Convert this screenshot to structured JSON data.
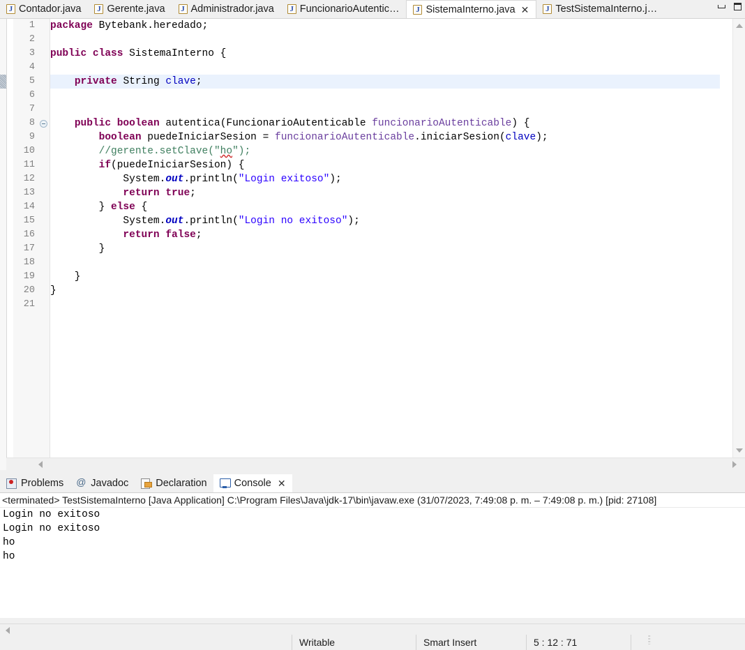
{
  "window": {
    "minimize_label": "Minimize",
    "maximize_label": "Maximize"
  },
  "editor_tabs": [
    {
      "label": "Contador.java",
      "icon": "java-file-icon",
      "active": false,
      "closable": false
    },
    {
      "label": "Gerente.java",
      "icon": "java-file-icon",
      "active": false,
      "closable": false
    },
    {
      "label": "Administrador.java",
      "icon": "java-file-icon",
      "active": false,
      "closable": false
    },
    {
      "label": "FuncionarioAutentic…",
      "icon": "java-file-icon",
      "active": false,
      "closable": false
    },
    {
      "label": "SistemaInterno.java",
      "icon": "java-file-icon",
      "active": true,
      "closable": true
    },
    {
      "label": "TestSistemaInterno.j…",
      "icon": "java-file-icon",
      "active": false,
      "closable": false
    }
  ],
  "editor": {
    "close_glyph": "✕",
    "highlighted_line": 5,
    "fold_marker_line": 8,
    "change_marker_line": 5,
    "line_count": 21,
    "lines": [
      {
        "n": 1,
        "text": "package Bytebank.heredado;"
      },
      {
        "n": 2,
        "text": ""
      },
      {
        "n": 3,
        "text": "public class SistemaInterno {"
      },
      {
        "n": 4,
        "text": ""
      },
      {
        "n": 5,
        "text": "    private String clave;"
      },
      {
        "n": 6,
        "text": ""
      },
      {
        "n": 7,
        "text": ""
      },
      {
        "n": 8,
        "text": "    public boolean autentica(FuncionarioAutenticable funcionarioAutenticable) {"
      },
      {
        "n": 9,
        "text": "        boolean puedeIniciarSesion = funcionarioAutenticable.iniciarSesion(clave);"
      },
      {
        "n": 10,
        "text": "        //gerente.setClave(\"ho\");"
      },
      {
        "n": 11,
        "text": "        if(puedeIniciarSesion) {"
      },
      {
        "n": 12,
        "text": "            System.out.println(\"Login exitoso\");"
      },
      {
        "n": 13,
        "text": "            return true;"
      },
      {
        "n": 14,
        "text": "        } else {"
      },
      {
        "n": 15,
        "text": "            System.out.println(\"Login no exitoso\");"
      },
      {
        "n": 16,
        "text": "            return false;"
      },
      {
        "n": 17,
        "text": "        }"
      },
      {
        "n": 18,
        "text": ""
      },
      {
        "n": 19,
        "text": "    }"
      },
      {
        "n": 20,
        "text": "}"
      },
      {
        "n": 21,
        "text": ""
      }
    ]
  },
  "view_tabs": [
    {
      "label": "Problems",
      "icon": "problems-icon",
      "active": false,
      "closable": false
    },
    {
      "label": "Javadoc",
      "icon": "javadoc-icon",
      "active": false,
      "closable": false
    },
    {
      "label": "Declaration",
      "icon": "declaration-icon",
      "active": false,
      "closable": false
    },
    {
      "label": "Console",
      "icon": "console-icon",
      "active": true,
      "closable": true
    }
  ],
  "console": {
    "close_glyph": "✕",
    "process_line": "<terminated> TestSistemaInterno [Java Application] C:\\Program Files\\Java\\jdk-17\\bin\\javaw.exe  (31/07/2023, 7:49:08 p. m. – 7:49:08 p. m.) [pid: 27108]",
    "output": [
      "Login no exitoso",
      "Login no exitoso",
      "ho",
      "ho"
    ]
  },
  "statusbar": {
    "writable": "Writable",
    "insert_mode": "Smart Insert",
    "cursor_position": "5 : 12 : 71"
  },
  "colors": {
    "keyword": "#7f0055",
    "string": "#2a00ff",
    "comment": "#3f7f5f",
    "field": "#0000c0",
    "parameter": "#6a3e9e",
    "highlight_row": "#eaf2fd",
    "tab_active_bg": "#ffffff",
    "chrome_bg": "#f0f0f0"
  }
}
